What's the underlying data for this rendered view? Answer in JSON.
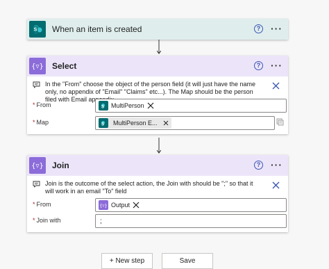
{
  "trigger": {
    "title": "When an item is created",
    "help": "?",
    "more": "···"
  },
  "select_card": {
    "title": "Select",
    "help": "?",
    "more": "···",
    "comment": "In the \"From\" choose the object of the person field (it will just have the name only, no appendix of \"Email\" \"Claims\" etc...). The Map should be the person filed with Email appendix.",
    "from": {
      "label": "From",
      "token": "MultiPerson"
    },
    "map": {
      "label": "Map",
      "token": "MultiPerson E..."
    }
  },
  "join_card": {
    "title": "Join",
    "help": "?",
    "more": "···",
    "comment": "Join is the outcome of the select action, the Join with should be \";\" so that it will work in an email \"To\" field",
    "from": {
      "label": "From",
      "token": "Output"
    },
    "join_with": {
      "label": "Join with",
      "value": ";"
    }
  },
  "footer": {
    "new_step": "+ New step",
    "save": "Save"
  },
  "colors": {
    "sharepoint": "#036c70",
    "data_operation": "#8c6cd9",
    "trigger_header": "#dfeeed",
    "action_header": "#ece5f9",
    "accent": "#3a55b3"
  },
  "icons": [
    "sharepoint-icon",
    "data-operation-icon",
    "help-icon",
    "more-icon",
    "comment-icon",
    "close-icon",
    "remove-token-icon",
    "switch-map-icon",
    "arrow-down-icon"
  ]
}
